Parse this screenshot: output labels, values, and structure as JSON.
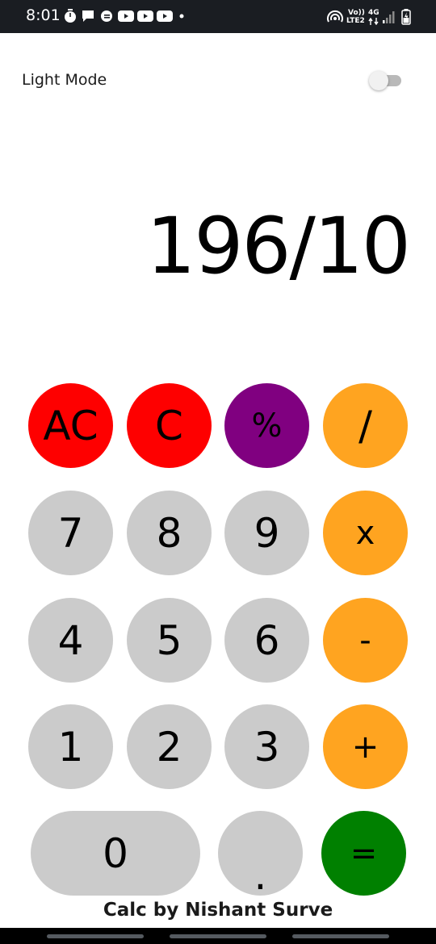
{
  "status_bar": {
    "time": "8:01",
    "volte_top": "Vo))",
    "volte_bottom": "LTE2",
    "network": "4G"
  },
  "header": {
    "mode_label": "Light Mode",
    "toggle_on": false
  },
  "display": {
    "expression": "196/10"
  },
  "keypad": {
    "ac": "AC",
    "c": "C",
    "percent": "%",
    "divide": "/",
    "seven": "7",
    "eight": "8",
    "nine": "9",
    "multiply": "x",
    "four": "4",
    "five": "5",
    "six": "6",
    "minus": "-",
    "one": "1",
    "two": "2",
    "three": "3",
    "plus": "+",
    "zero": "0",
    "dot": ".",
    "equals": "="
  },
  "footer": {
    "credit": "Calc by Nishant Surve"
  },
  "colors": {
    "clear": "#fe0000",
    "percent": "#800080",
    "operator": "#ffa420",
    "digit": "#cbcbcb",
    "equals": "#008000"
  }
}
